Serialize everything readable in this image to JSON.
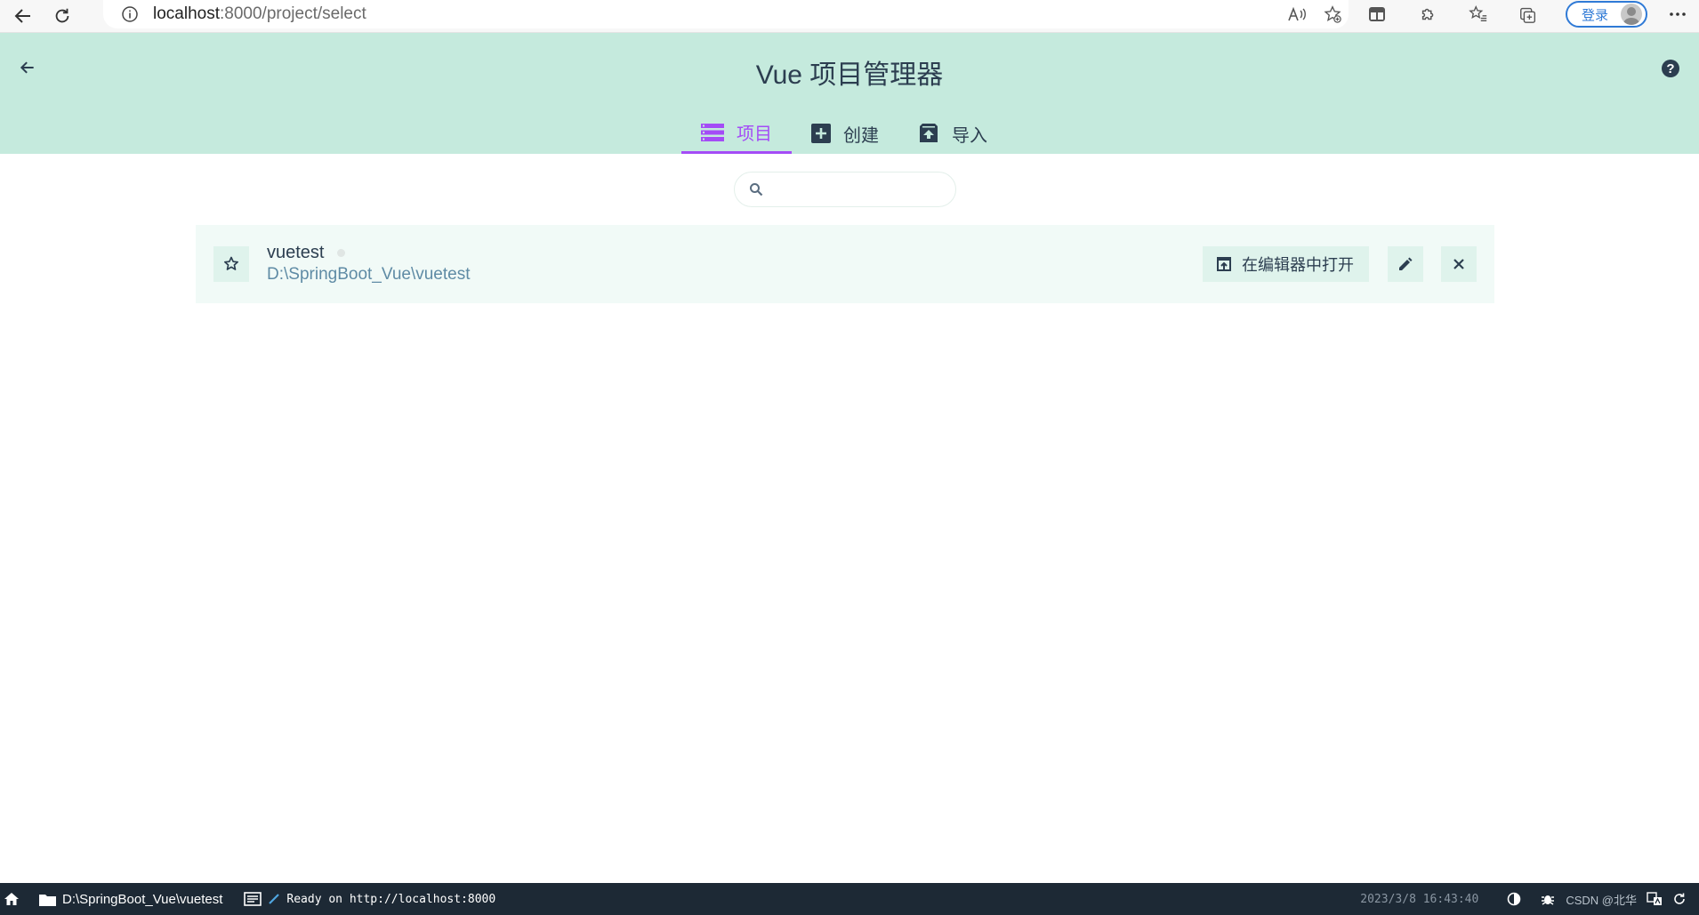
{
  "browser": {
    "url_host": "localhost",
    "url_rest": ":8000/project/select",
    "login_label": "登录"
  },
  "header": {
    "title": "Vue 项目管理器",
    "help_label": "?",
    "tabs": [
      {
        "label": "项目",
        "icon": "list-icon",
        "active": true
      },
      {
        "label": "创建",
        "icon": "add-box-icon",
        "active": false
      },
      {
        "label": "导入",
        "icon": "unarchive-icon",
        "active": false
      }
    ]
  },
  "search": {
    "value": "",
    "placeholder": ""
  },
  "projects": [
    {
      "name": "vuetest",
      "path": "D:\\SpringBoot_Vue\\vuetest",
      "open_label": "在编辑器中打开"
    }
  ],
  "status_bar": {
    "cwd": "D:\\SpringBoot_Vue\\vuetest",
    "log": "Ready on http://localhost:8000",
    "time": "2023/3/8 16:43:40",
    "watermark": "CSDN @北华"
  },
  "colors": {
    "header_bg": "#c5eadd",
    "accent": "#a44cf6",
    "status_bar_bg": "#1d2935"
  }
}
